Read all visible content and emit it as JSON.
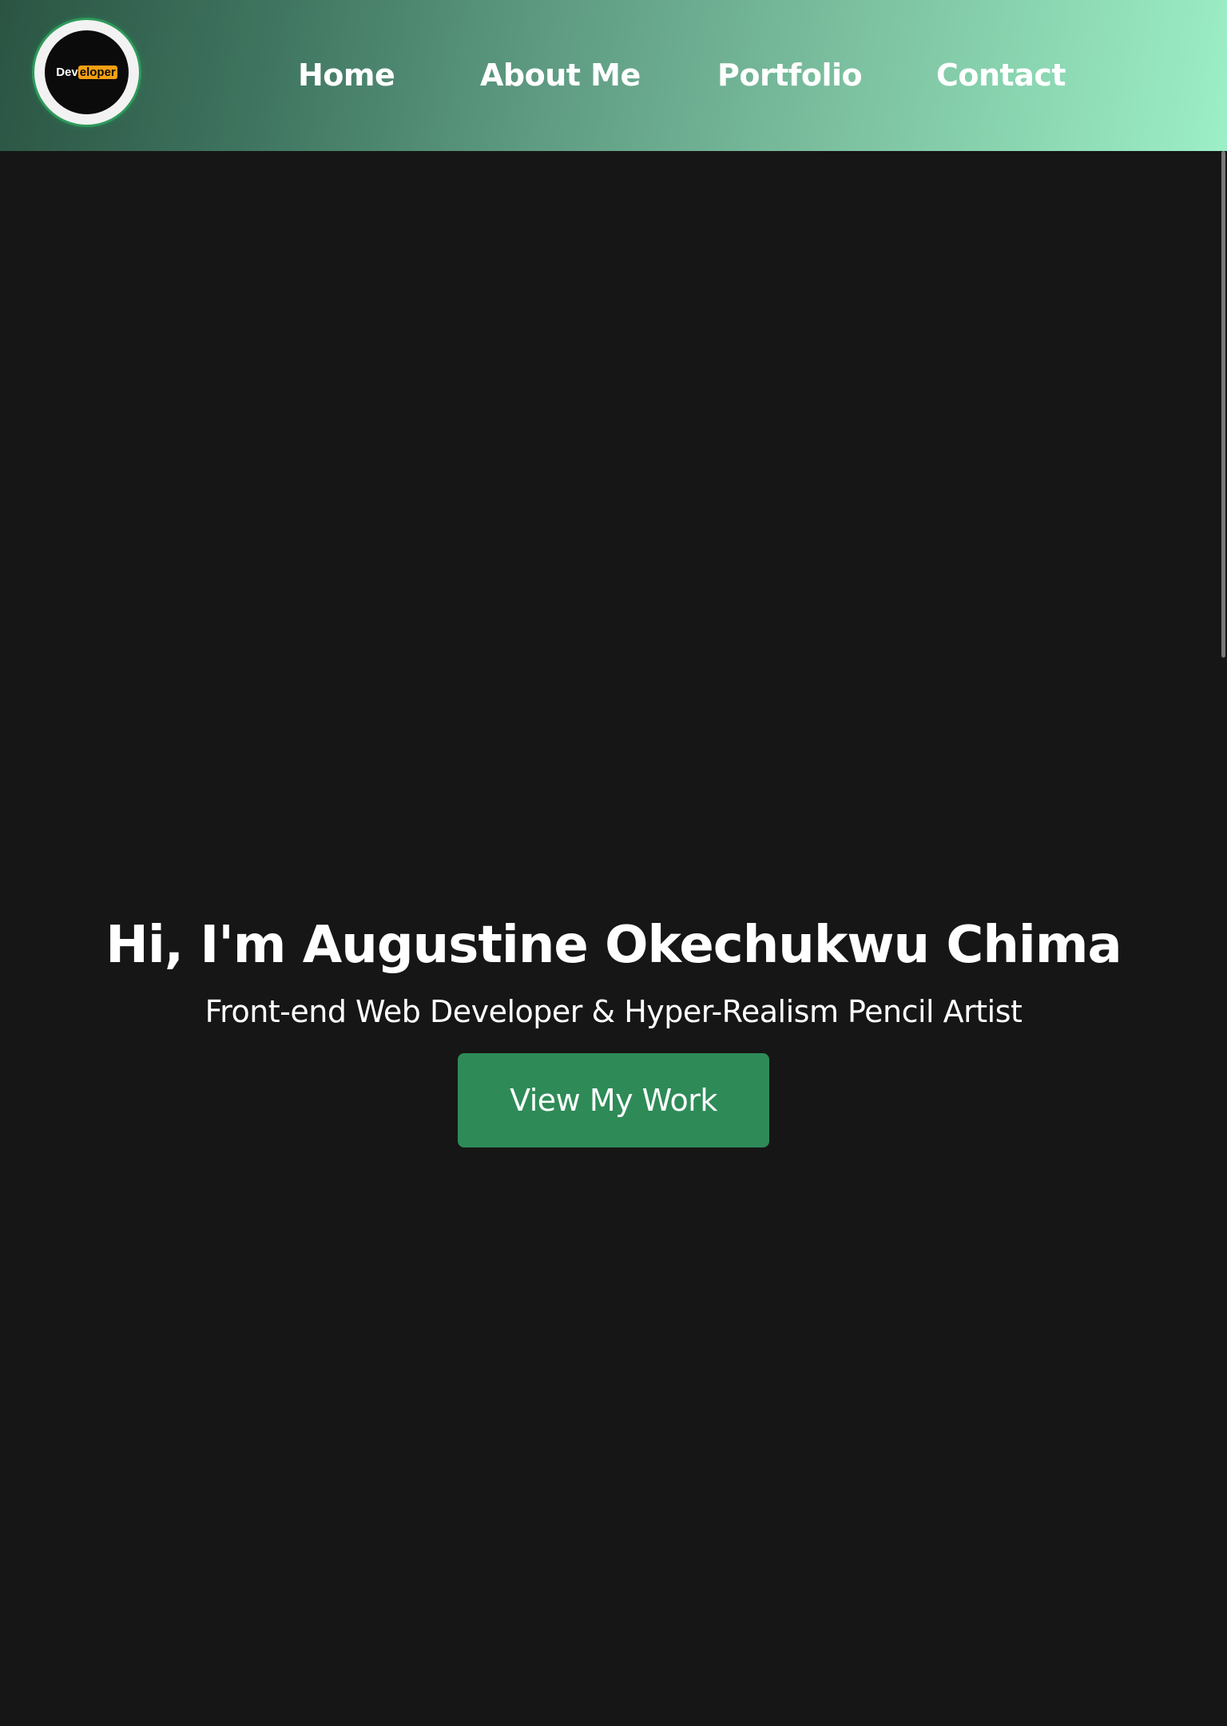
{
  "logo": {
    "text_part1": "Dev",
    "text_part2": "eloper",
    "highlight_color": "#f5a011",
    "ring_glow_color": "#2e9a5a"
  },
  "nav": {
    "items": [
      {
        "label": "Home"
      },
      {
        "label": "About Me"
      },
      {
        "label": "Portfolio"
      },
      {
        "label": "Contact"
      }
    ],
    "gradient_colors": [
      "#2b5443",
      "#9cefc6"
    ]
  },
  "hero": {
    "title": "Hi, I'm Augustine Okechukwu Chima",
    "subtitle": "Front-end Web Developer & Hyper-Realism Pencil Artist",
    "cta_label": "View My Work",
    "cta_color": "#2e8b57"
  },
  "colors": {
    "background": "#161616",
    "text": "#ffffff"
  }
}
